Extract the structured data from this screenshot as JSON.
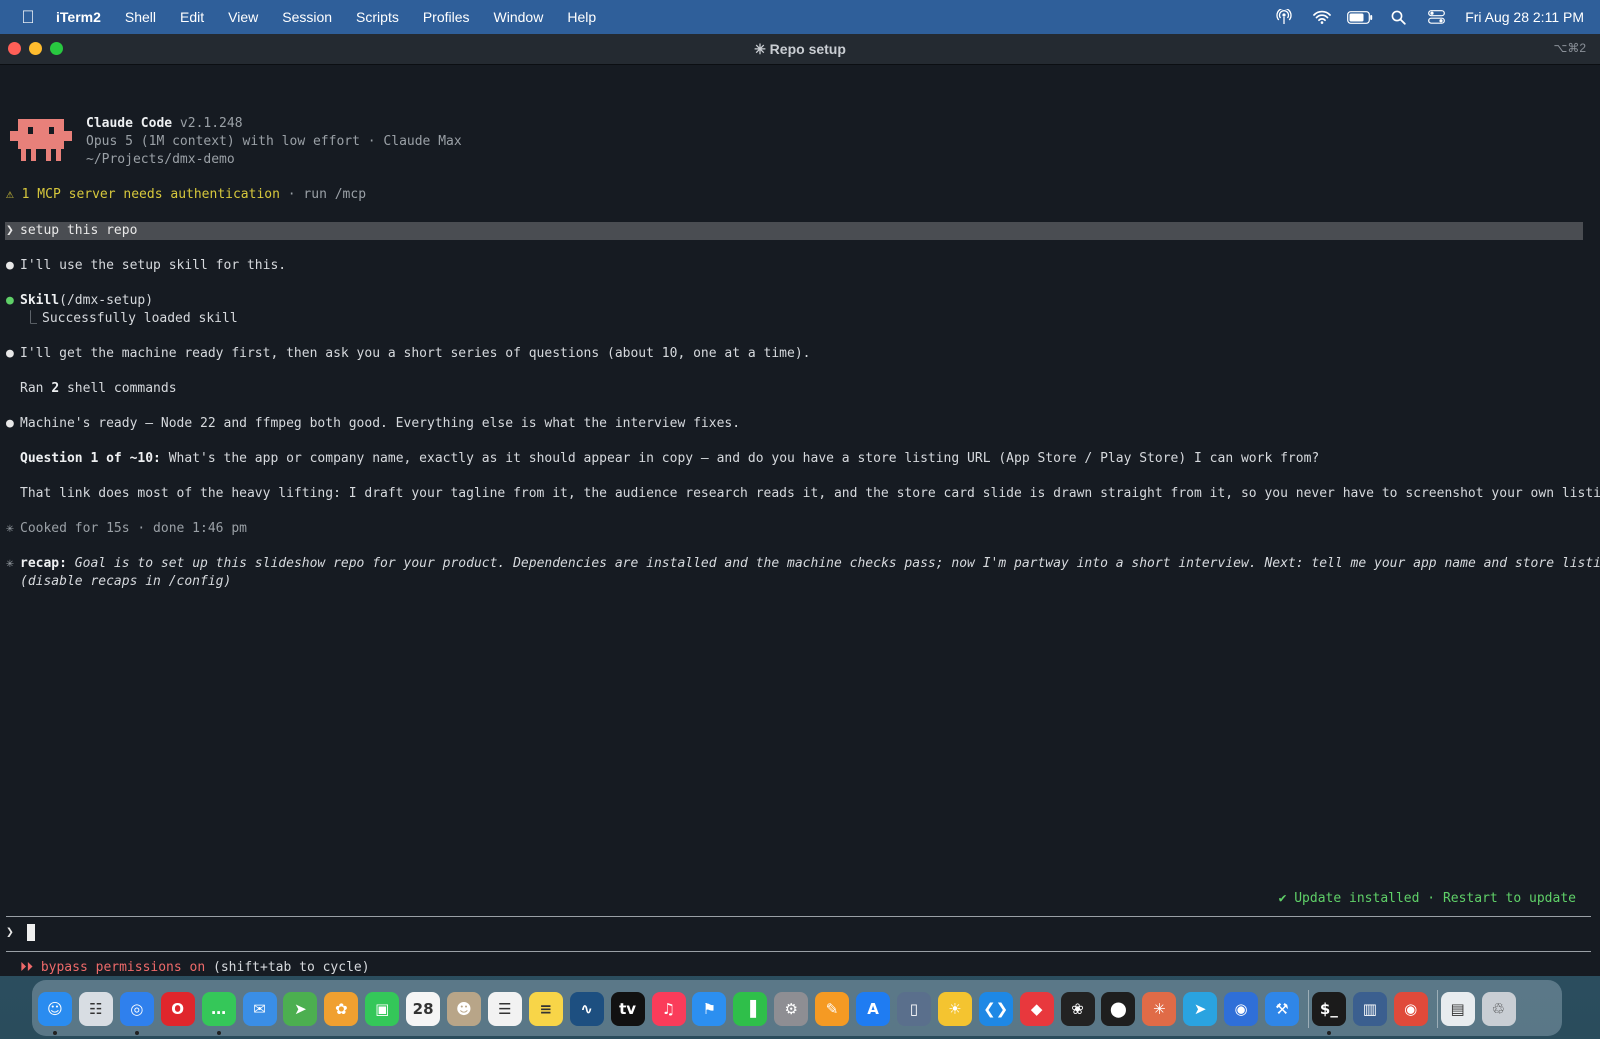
{
  "menubar": {
    "apple_icon": "apple-icon",
    "app_name": "iTerm2",
    "menus": [
      "Shell",
      "Edit",
      "View",
      "Session",
      "Scripts",
      "Profiles",
      "Window",
      "Help"
    ],
    "status_icons": [
      "broadcast-icon",
      "wifi-icon",
      "battery-icon",
      "spotlight-icon",
      "control-center-icon"
    ],
    "clock": "Fri Aug 28  2:11 PM"
  },
  "window": {
    "title": "✳ Repo setup",
    "shortcut": "⌥⌘2"
  },
  "header": {
    "product": "Claude Code",
    "version": "v2.1.248",
    "model_line": "Opus 5 (1M context) with low effort · Claude Max",
    "path": "~/Projects/dmx-demo"
  },
  "warning": {
    "icon": "⚠",
    "text": "1 MCP server needs authentication",
    "hint": " · run /mcp"
  },
  "prompt": {
    "symbol": "❯",
    "text": "setup this repo"
  },
  "transcript": {
    "bullet": "●",
    "msg1": "I'll use the setup skill for this.",
    "skill_name": "Skill",
    "skill_arg": "(/dmx-setup)",
    "skill_branch": "⎿",
    "skill_result": "Successfully loaded skill",
    "msg2": "I'll get the machine ready first, then ask you a short series of questions (about 10, one at a time).",
    "ran_prefix": "Ran ",
    "ran_count": "2",
    "ran_suffix": " shell commands",
    "msg3": "Machine's ready — Node 22 and ffmpeg both good. Everything else is what the interview fixes.",
    "question_label": "Question 1 of ~10:",
    "question_text": " What's the app or company name, exactly as it should appear in copy — and do you have a store listing URL (App Store / Play Store) I can work from?",
    "para": "That link does most of the heavy lifting: I draft your tagline from it, the audience research reads it, and the store card slide is drawn straight from it, so you never have to screenshot your own listing.",
    "asterisk": "✳",
    "cooked": "Cooked for 15s · done 1:46 pm",
    "recap_label": "recap:",
    "recap_text": " Goal is to set up this slideshow repo for your product. Dependencies are installed and the machine checks pass; now I'm partway into a short interview. Next: tell me your app name and store listing URL.",
    "recap_disable": "(disable recaps in /config)"
  },
  "footer": {
    "update_text": "✔ Update installed · Restart to update",
    "input_symbol": "❯",
    "bypass_icon": "⏵⏵",
    "bypass_text": "bypass permissions on",
    "bypass_hint": " (shift+tab to cycle)"
  },
  "dock": {
    "icons": [
      {
        "name": "finder-icon",
        "glyph": "☺",
        "color": "#2a8cf0"
      },
      {
        "name": "launchpad-icon",
        "glyph": "☷",
        "color": "#d8dde3"
      },
      {
        "name": "safari-icon",
        "glyph": "◎",
        "color": "#2f80ed"
      },
      {
        "name": "opera-icon",
        "glyph": "O",
        "color": "#e0262c"
      },
      {
        "name": "messages-icon",
        "glyph": "…",
        "color": "#35c759"
      },
      {
        "name": "mail-icon",
        "glyph": "✉",
        "color": "#3a8ee6"
      },
      {
        "name": "maps-icon",
        "glyph": "➤",
        "color": "#4caf50"
      },
      {
        "name": "photos-icon",
        "glyph": "✿",
        "color": "#f0a030"
      },
      {
        "name": "facetime-icon",
        "glyph": "▣",
        "color": "#34c759"
      },
      {
        "name": "calendar-icon",
        "glyph": "28",
        "color": "#f5f5f5"
      },
      {
        "name": "contacts-icon",
        "glyph": "☻",
        "color": "#b8a588"
      },
      {
        "name": "reminders-icon",
        "glyph": "☰",
        "color": "#f2f2f2"
      },
      {
        "name": "notes-icon",
        "glyph": "≡",
        "color": "#f8d548"
      },
      {
        "name": "freeform-icon",
        "glyph": "∿",
        "color": "#1d4f80"
      },
      {
        "name": "tv-icon",
        "glyph": "tv",
        "color": "#111111"
      },
      {
        "name": "music-icon",
        "glyph": "♫",
        "color": "#fa3c5a"
      },
      {
        "name": "keynote-icon",
        "glyph": "⚑",
        "color": "#2c8ff0"
      },
      {
        "name": "numbers-icon",
        "glyph": "▐",
        "color": "#2fbf4a"
      },
      {
        "name": "system-settings-icon",
        "glyph": "⚙",
        "color": "#8e8e93"
      },
      {
        "name": "pages-icon",
        "glyph": "✎",
        "color": "#f59a23"
      },
      {
        "name": "app-store-icon",
        "glyph": "A",
        "color": "#1f7cf2"
      },
      {
        "name": "simulator-icon",
        "glyph": "▯",
        "color": "#5a6f8c"
      },
      {
        "name": "cyberduck-icon",
        "glyph": "☀",
        "color": "#f4c430"
      },
      {
        "name": "vscode-icon",
        "glyph": "❮❯",
        "color": "#1e88e5"
      },
      {
        "name": "git-client-icon",
        "glyph": "◆",
        "color": "#e8383d"
      },
      {
        "name": "chatgpt-icon",
        "glyph": "❀",
        "color": "#222222"
      },
      {
        "name": "figma-icon",
        "glyph": "⬤",
        "color": "#1e1e1e"
      },
      {
        "name": "claude-icon",
        "glyph": "✳",
        "color": "#e06b47"
      },
      {
        "name": "telegram-icon",
        "glyph": "➤",
        "color": "#2aa3e0"
      },
      {
        "name": "proxyman-icon",
        "glyph": "◉",
        "color": "#2f6fd8"
      },
      {
        "name": "xcode-icon",
        "glyph": "⚒",
        "color": "#2f86e8"
      },
      {
        "name": "terminal-icon",
        "glyph": "$_",
        "color": "#1b1b1b"
      },
      {
        "name": "iphone-mirroring-icon",
        "glyph": "▥",
        "color": "#3b5f8f"
      },
      {
        "name": "chrome-icon",
        "glyph": "◉",
        "color": "#e04a3a"
      },
      {
        "name": "downloads-icon",
        "glyph": "▤",
        "color": "#e8ecef"
      },
      {
        "name": "trash-icon",
        "glyph": "♲",
        "color": "#c9ced4"
      }
    ]
  }
}
